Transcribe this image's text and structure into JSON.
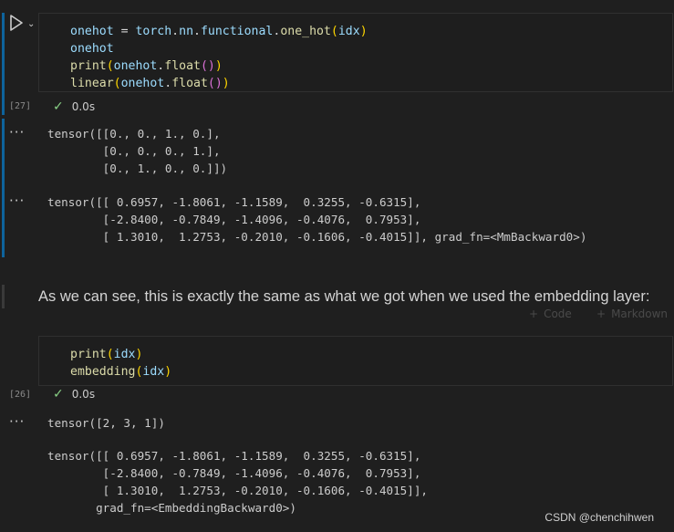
{
  "cell1": {
    "code_lines": [
      {
        "parts": [
          {
            "t": "onehot",
            "c": "var"
          },
          {
            "t": " = ",
            "c": "op"
          },
          {
            "t": "torch",
            "c": "var"
          },
          {
            "t": ".",
            "c": "op"
          },
          {
            "t": "nn",
            "c": "var"
          },
          {
            "t": ".",
            "c": "op"
          },
          {
            "t": "functional",
            "c": "var"
          },
          {
            "t": ".",
            "c": "op"
          },
          {
            "t": "one_hot",
            "c": "fn"
          },
          {
            "t": "(",
            "c": "p1"
          },
          {
            "t": "idx",
            "c": "var"
          },
          {
            "t": ")",
            "c": "p1"
          }
        ]
      },
      {
        "parts": [
          {
            "t": "onehot",
            "c": "var"
          }
        ]
      },
      {
        "parts": [
          {
            "t": "print",
            "c": "fn"
          },
          {
            "t": "(",
            "c": "p1"
          },
          {
            "t": "onehot",
            "c": "var"
          },
          {
            "t": ".",
            "c": "op"
          },
          {
            "t": "float",
            "c": "fn"
          },
          {
            "t": "()",
            "c": "p2"
          },
          {
            "t": ")",
            "c": "p1"
          }
        ]
      },
      {
        "parts": [
          {
            "t": "linear",
            "c": "fn"
          },
          {
            "t": "(",
            "c": "p1"
          },
          {
            "t": "onehot",
            "c": "var"
          },
          {
            "t": ".",
            "c": "op"
          },
          {
            "t": "float",
            "c": "fn"
          },
          {
            "t": "()",
            "c": "p2"
          },
          {
            "t": ")",
            "c": "p1"
          }
        ]
      }
    ],
    "exec_count": "[27]",
    "duration": "0.0s",
    "output_1": "tensor([[0., 0., 1., 0.],\n        [0., 0., 0., 1.],\n        [0., 1., 0., 0.]])",
    "output_2": "tensor([[ 0.6957, -1.8061, -1.1589,  0.3255, -0.6315],\n        [-2.8400, -0.7849, -1.4096, -0.4076,  0.7953],\n        [ 1.3010,  1.2753, -0.2010, -0.1606, -0.4015]], grad_fn=<MmBackward0>)"
  },
  "markdown": {
    "text": "As we can see, this is exactly the same as what we got when we used the embedding layer:",
    "add_code_label": "Code",
    "add_markdown_label": "Markdown"
  },
  "cell2": {
    "code_lines": [
      {
        "parts": [
          {
            "t": "print",
            "c": "fn"
          },
          {
            "t": "(",
            "c": "p1"
          },
          {
            "t": "idx",
            "c": "var"
          },
          {
            "t": ")",
            "c": "p1"
          }
        ]
      },
      {
        "parts": [
          {
            "t": "embedding",
            "c": "fn"
          },
          {
            "t": "(",
            "c": "p1"
          },
          {
            "t": "idx",
            "c": "var"
          },
          {
            "t": ")",
            "c": "p1"
          }
        ]
      }
    ],
    "exec_count": "[26]",
    "duration": "0.0s",
    "output_1": "tensor([2, 3, 1])",
    "output_2": "tensor([[ 0.6957, -1.8061, -1.1589,  0.3255, -0.6315],\n        [-2.8400, -0.7849, -1.4096, -0.4076,  0.7953],\n        [ 1.3010,  1.2753, -0.2010, -0.1606, -0.4015]],\n       grad_fn=<EmbeddingBackward0>)"
  },
  "output_menu_glyph": "···",
  "watermark": "CSDN @chenchihwen",
  "icons": {
    "run": "run-icon",
    "chevron": "chevron-down-icon",
    "check": "check-icon",
    "plus": "plus-icon"
  },
  "colors": {
    "background": "#1f1f1f",
    "accent_bar": "#0e639c",
    "success_check": "#89d185"
  }
}
